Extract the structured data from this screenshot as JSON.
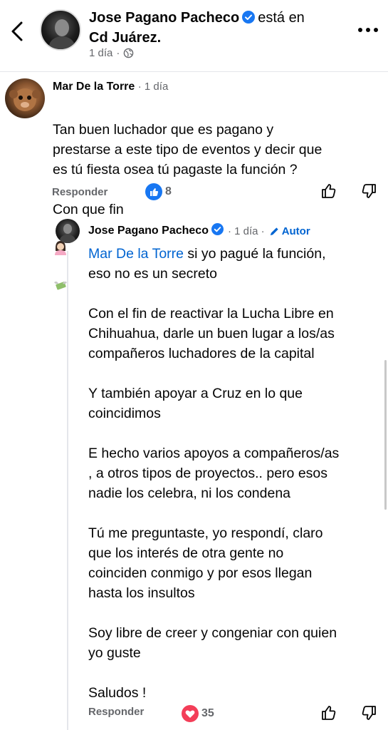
{
  "header": {
    "author_name": "Jose Pagano Pacheco",
    "location_text": "está en",
    "location": "Cd Juárez.",
    "time": "1 día",
    "privacy_icon": "globe-icon",
    "back_icon": "chevron-left-icon",
    "more_icon": "more-horizontal-icon"
  },
  "comment": {
    "author": "Mar De la Torre",
    "time": "1 día",
    "text": "Tan buen luchador que es  pagano y\nprestarse a este tipo de eventos y decir que\nes tú fiesta osea tú  pagaste la función ?",
    "text_last_line": "Con que fin",
    "emojis": [
      "woman-emoji",
      "money-with-wings-emoji"
    ],
    "reply_label": "Responder",
    "reaction_count": "8",
    "reaction_icon": "like-reaction-icon",
    "like_icon": "thumbs-up-icon",
    "dislike_icon": "thumbs-down-icon"
  },
  "reply": {
    "author": "Jose Pagano Pacheco",
    "time": "1 día",
    "author_badge": "Autor",
    "mention": "Mar De la Torre",
    "paragraphs": [
      "  si yo pagué la función,\neso no es un secreto",
      "Con el fin de  reactivar la Lucha Libre en\nChihuahua, darle un buen lugar a los/as\ncompañeros luchadores de la capital",
      "Y también apoyar a Cruz en lo que\ncoincidimos",
      " E hecho varios apoyos a compañeros/as\n, a otros tipos de proyectos.. pero esos\nnadie los celebra, ni los condena",
      "Tú me preguntaste, yo respondí, claro\nque los interés de otra gente no\ncoinciden conmigo y por esos llegan\nhasta los insultos",
      "Soy libre de creer y congeniar con quien\nyo guste",
      "Saludos !"
    ],
    "reply_label": "Responder",
    "reaction_count": "35",
    "reaction_icon": "love-reaction-icon",
    "like_icon": "thumbs-up-icon",
    "dislike_icon": "thumbs-down-icon"
  },
  "colors": {
    "link_blue": "#0064d1",
    "secondary_text": "#65676b",
    "like_blue": "#1877f2",
    "love_red": "#f33e58"
  }
}
